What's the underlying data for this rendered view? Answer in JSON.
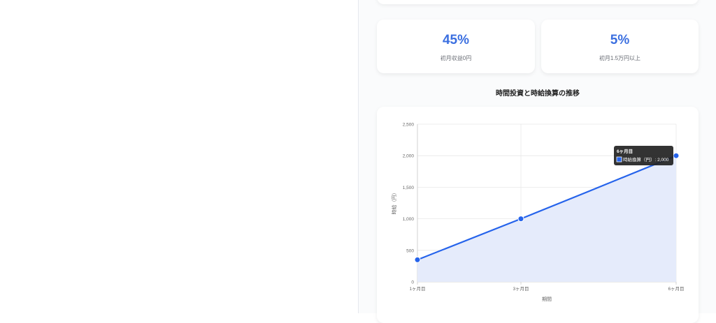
{
  "stats": [
    {
      "value": "45%",
      "label": "初月収益0円"
    },
    {
      "value": "5%",
      "label": "初月1.5万円以上"
    }
  ],
  "section_title": "時間投資と時給換算の推移",
  "chart_data": {
    "type": "area",
    "categories": [
      "1ヶ月目",
      "3ヶ月目",
      "6ヶ月目"
    ],
    "x": [
      1,
      3,
      6
    ],
    "series": [
      {
        "name": "時給換算（円）",
        "values": [
          350,
          1000,
          2000
        ],
        "color": "#2563eb",
        "fill": "#e5ebfb"
      }
    ],
    "xlabel": "期間",
    "ylabel": "時給（円）",
    "ylim": [
      0,
      2500
    ],
    "yticks": [
      0,
      500,
      1000,
      1500,
      2000,
      2500
    ],
    "ytick_labels": [
      "0",
      "500",
      "1,000",
      "1,500",
      "2,000",
      "2,500"
    ],
    "grid": true,
    "tooltip": {
      "title": "6ヶ月目",
      "text": "時給換算（円）: 2,000"
    }
  }
}
